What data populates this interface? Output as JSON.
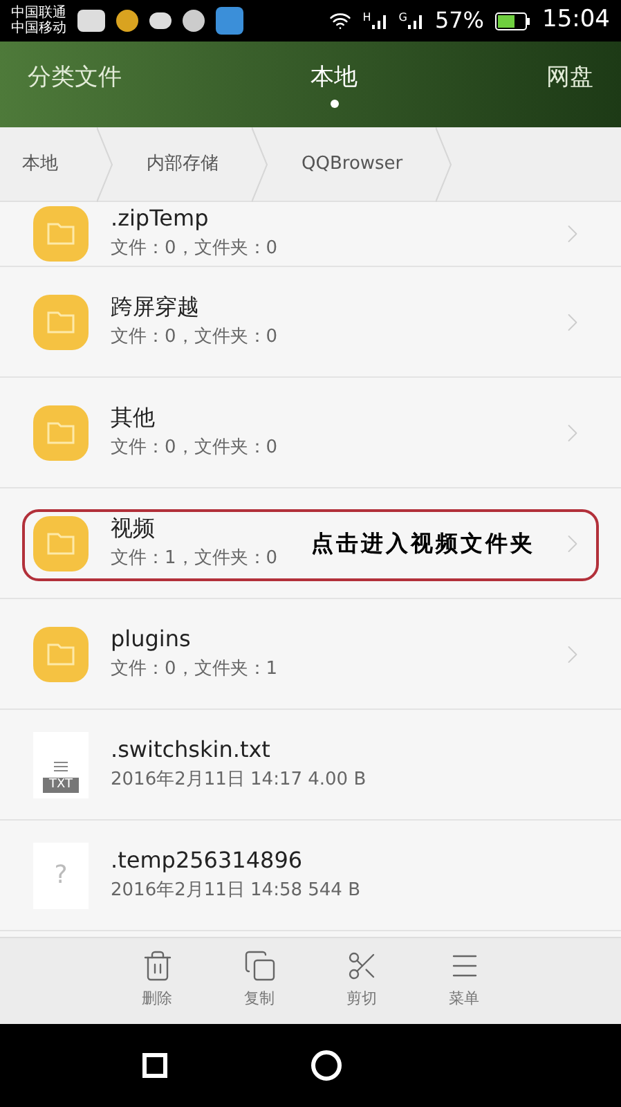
{
  "status_bar": {
    "carriers": [
      "中国联通",
      "中国移动"
    ],
    "signals": [
      "H",
      "G"
    ],
    "battery": "57%",
    "time": "15:04"
  },
  "tabs": [
    {
      "label": "分类文件",
      "selected": false
    },
    {
      "label": "本地",
      "selected": true
    },
    {
      "label": "网盘",
      "selected": false
    }
  ],
  "breadcrumb": [
    "本地",
    "内部存储",
    "QQBrowser"
  ],
  "files": [
    {
      "kind": "folder",
      "name": ".zipTemp",
      "info": "文件：0，文件夹：0",
      "clipped": true
    },
    {
      "kind": "folder",
      "name": "跨屏穿越",
      "info": "文件：0，文件夹：0"
    },
    {
      "kind": "folder",
      "name": "其他",
      "info": "文件：0，文件夹：0"
    },
    {
      "kind": "folder",
      "name": "视频",
      "info": "文件：1，文件夹：0",
      "annotation": "点击进入视频文件夹"
    },
    {
      "kind": "folder",
      "name": "plugins",
      "info": "文件：0，文件夹：1"
    },
    {
      "kind": "txt",
      "name": ".switchskin.txt",
      "info": "2016年2月11日 14:17 4.00 B",
      "badge": "TXT"
    },
    {
      "kind": "unknown",
      "name": ".temp256314896",
      "info": "2016年2月11日 14:58 544 B",
      "glyph": "?"
    }
  ],
  "toolbar": [
    {
      "kind": "delete",
      "label": "删除"
    },
    {
      "kind": "copy",
      "label": "复制"
    },
    {
      "kind": "cut",
      "label": "剪切"
    },
    {
      "kind": "menu",
      "label": "菜单"
    }
  ]
}
